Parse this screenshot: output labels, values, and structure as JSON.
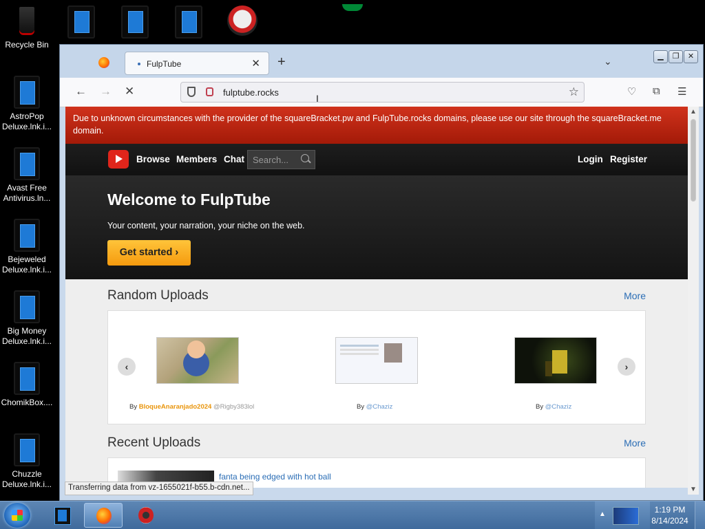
{
  "desktop": {
    "icons": [
      {
        "label": "Recycle Bin"
      },
      {
        "label": "AstroPop Deluxe.lnk.i..."
      },
      {
        "label": "Avast Free Antivirus.ln..."
      },
      {
        "label": "Bejeweled Deluxe.lnk.i..."
      },
      {
        "label": "Big Money Deluxe.lnk.i..."
      },
      {
        "label": "ChomikBox...."
      },
      {
        "label": "Chuzzle Deluxe.lnk.i..."
      }
    ]
  },
  "browser": {
    "tab_title": "FulpTube",
    "url": "fulptube.rocks",
    "status": "Transferring data from vz-1655021f-b55.b-cdn.net..."
  },
  "site": {
    "notice": "Due to unknown circumstances with the provider of the squareBracket.pw and FulpTube.rocks domains, please use our site through the squareBracket.me domain.",
    "nav": {
      "browse": "Browse",
      "members": "Members",
      "chat": "Chat",
      "search_placeholder": "Search...",
      "login": "Login",
      "register": "Register"
    },
    "hero": {
      "title": "Welcome to FulpTube",
      "subtitle": "Your content, your narration, your niche on the web.",
      "cta": "Get started ›"
    },
    "random": {
      "title": "Random Uploads",
      "more": "More",
      "items": [
        {
          "by": "By",
          "user": "BloqueAnaranjado2024",
          "extra": "@Rigby383lol"
        },
        {
          "by": "By",
          "user": "@Chaziz"
        },
        {
          "by": "By",
          "user": "@Chaziz"
        }
      ]
    },
    "recent": {
      "title": "Recent Uploads",
      "more": "More",
      "items": [
        {
          "title": "fanta being edged with hot ball"
        }
      ]
    }
  },
  "taskbar": {
    "time": "1:19 PM",
    "date": "8/14/2024"
  }
}
